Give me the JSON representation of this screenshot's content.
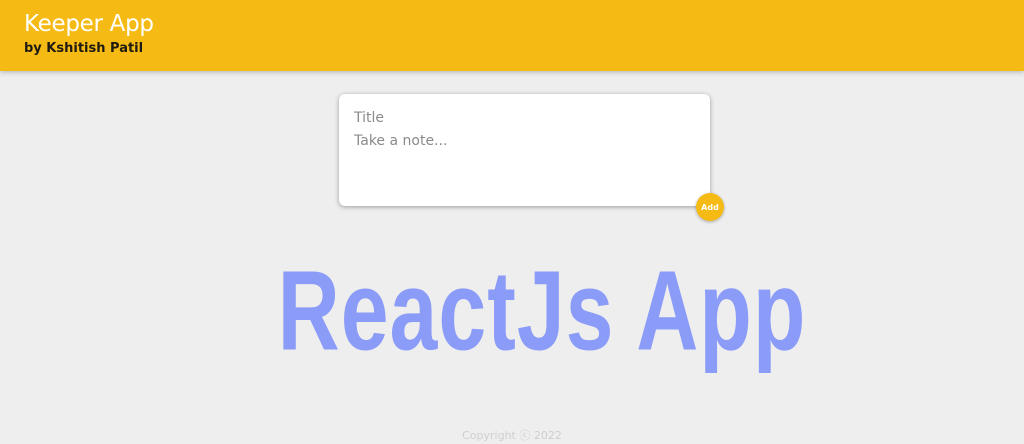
{
  "header": {
    "title": "Keeper App",
    "subtitle": "by Kshitish Patil"
  },
  "note_form": {
    "title_placeholder": "Title",
    "content_placeholder": "Take a note...",
    "add_label": "Add"
  },
  "banner": {
    "text": "ReactJs App"
  },
  "footer": {
    "copyright": "Copyright ⓒ 2022"
  },
  "colors": {
    "header_bg": "#f5ba13",
    "page_bg": "#eeeeee",
    "banner_text": "#8b9bf8"
  }
}
